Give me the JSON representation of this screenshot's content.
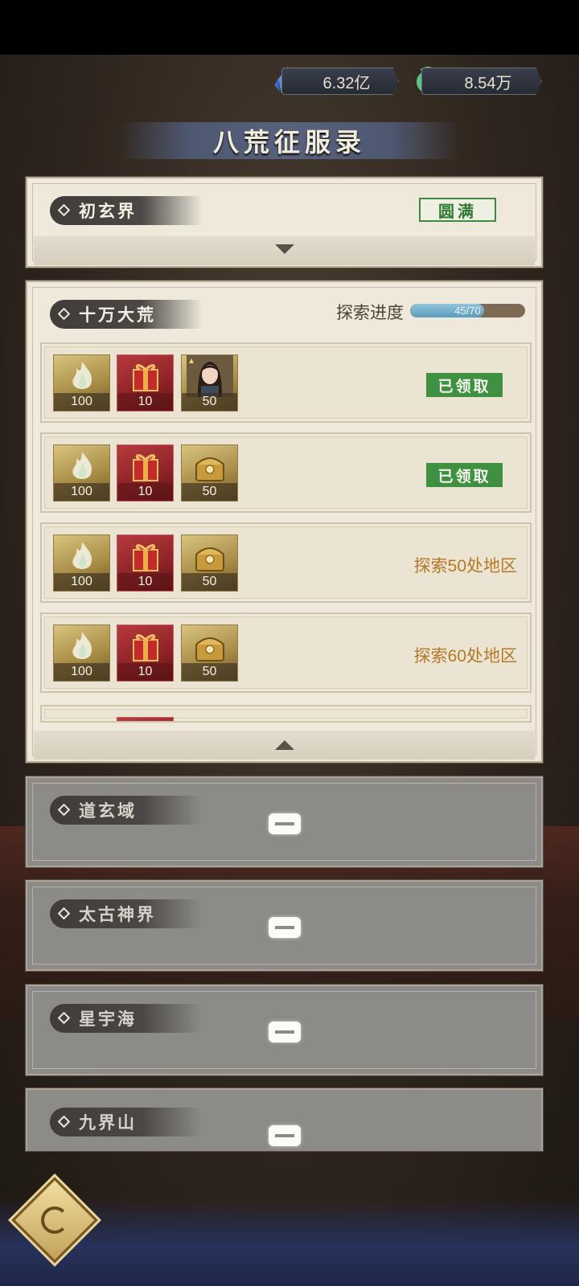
{
  "currencies": [
    {
      "icon": "blue-crystal-icon",
      "value": "6.32亿"
    },
    {
      "icon": "jade-coin-icon",
      "value": "8.54万"
    }
  ],
  "title": "八荒征服录",
  "regions": {
    "chuxuan": {
      "name": "初玄界",
      "status": "圆满"
    },
    "shiwan": {
      "name": "十万大荒",
      "progress_label": "探索进度",
      "progress_text": "45/70",
      "progress_value": 45,
      "progress_max": 70,
      "rows": [
        {
          "items": [
            {
              "kind": "spirit-flame",
              "count": "100"
            },
            {
              "kind": "red-giftbox",
              "count": "10"
            },
            {
              "kind": "character-portrait",
              "count": "50"
            }
          ],
          "state": "已领取"
        },
        {
          "items": [
            {
              "kind": "spirit-flame",
              "count": "100"
            },
            {
              "kind": "red-giftbox",
              "count": "10"
            },
            {
              "kind": "gold-chest",
              "count": "50"
            }
          ],
          "state": "已领取"
        },
        {
          "items": [
            {
              "kind": "spirit-flame",
              "count": "100"
            },
            {
              "kind": "red-giftbox",
              "count": "10"
            },
            {
              "kind": "gold-chest",
              "count": "50"
            }
          ],
          "state": "探索50处地区"
        },
        {
          "items": [
            {
              "kind": "spirit-flame",
              "count": "100"
            },
            {
              "kind": "red-giftbox",
              "count": "10"
            },
            {
              "kind": "gold-chest",
              "count": "50"
            }
          ],
          "state": "探索60处地区"
        }
      ]
    },
    "locked": [
      {
        "name": "道玄域"
      },
      {
        "name": "太古神界"
      },
      {
        "name": "星宇海"
      },
      {
        "name": "九界山"
      }
    ]
  },
  "colors": {
    "claimed_green": "#3f9141",
    "requirement_orange": "#b57825",
    "progress_blue": "#5d9dbc"
  }
}
